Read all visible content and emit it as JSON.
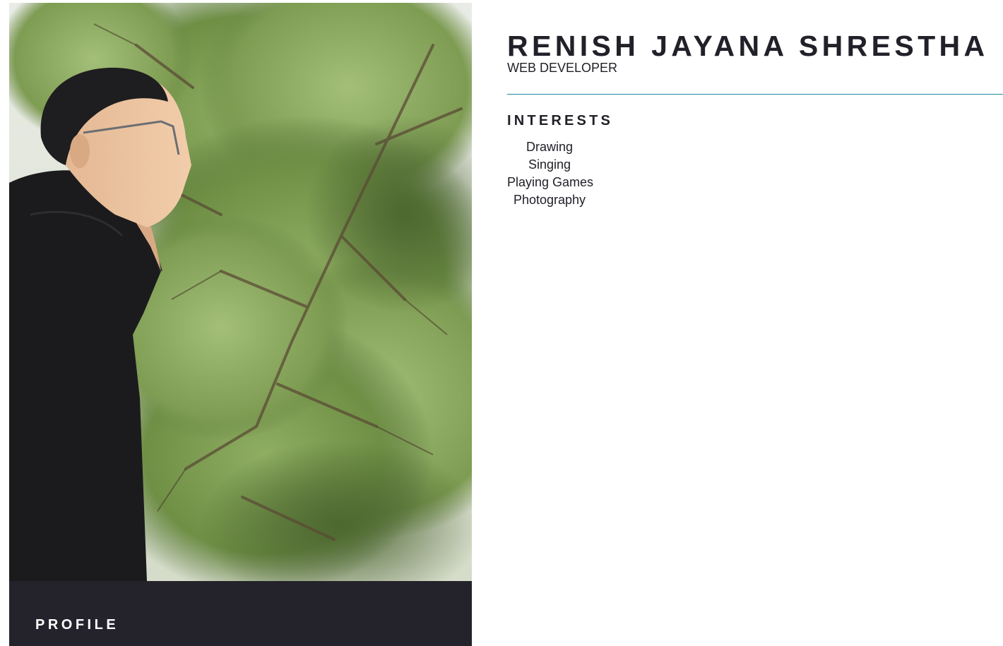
{
  "header": {
    "name": "RENISH JAYANA SHRESTHA",
    "role": "WEB DEVELOPER"
  },
  "profile_card": {
    "photo_alt": "photo",
    "label": "PROFILE"
  },
  "interests": {
    "heading": "INTERESTS",
    "items": [
      {
        "label": "Drawing"
      },
      {
        "label": "Singing"
      },
      {
        "label": "Playing Games"
      },
      {
        "label": "Photography"
      }
    ]
  },
  "colors": {
    "accent_line": "#1c8a9f",
    "profile_bar": "#24222b",
    "text": "#222028"
  }
}
